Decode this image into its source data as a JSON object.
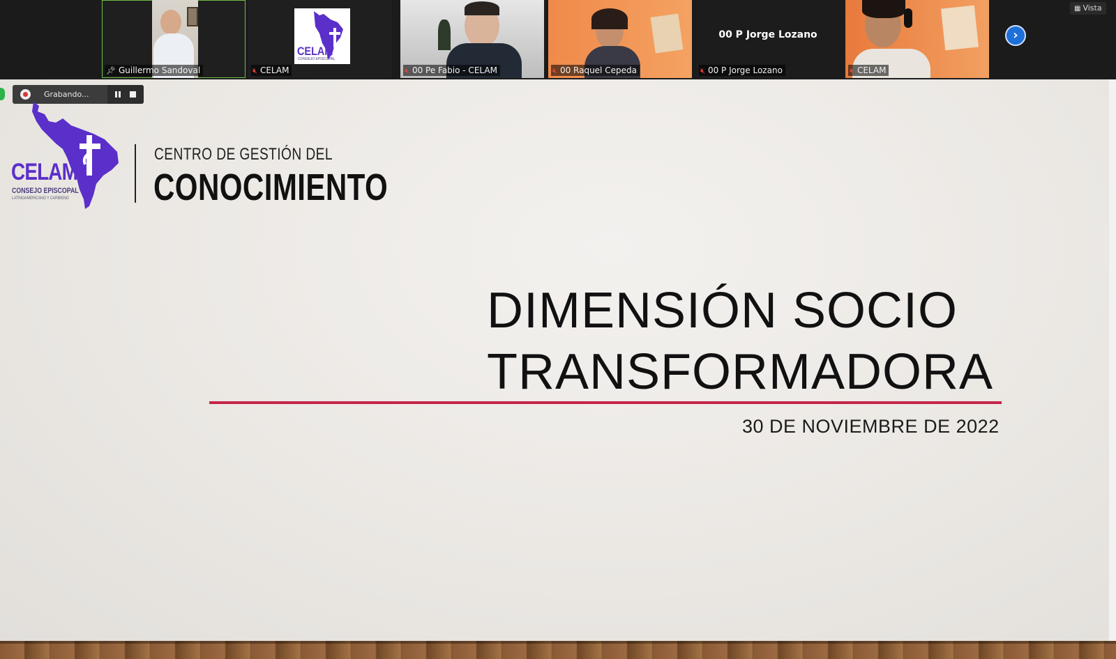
{
  "participants": [
    {
      "display_name": "Guillermo Sandoval",
      "mic": "pinned",
      "active": true
    },
    {
      "display_name": "CELAM",
      "mic": "muted",
      "active": false
    },
    {
      "display_name": "00 Pe Fabio - CELAM",
      "mic": "muted",
      "active": false
    },
    {
      "display_name": "00 Raquel Cepeda",
      "mic": "muted",
      "active": false
    },
    {
      "display_name": "00 P Jorge Lozano",
      "mic": "muted",
      "active": false,
      "video_off_label": "00 P Jorge Lozano"
    },
    {
      "display_name": "CELAM",
      "mic": "muted",
      "active": false
    }
  ],
  "view_button_label": "Vista",
  "recording": {
    "status_label": "Grabando..."
  },
  "slide": {
    "logo": {
      "brand": "CELAM",
      "brand_sub": "CONSEJO EPISCOPAL",
      "brand_sub2": "LATINOAMERICANO Y CARIBEÑO",
      "tile_logo_sub": "CONSEJO EPISCOPAL",
      "line1": "CENTRO DE GESTIÓN DEL",
      "line2": "CONOCIMIENTO"
    },
    "title_line1": "DIMENSIÓN SOCIO",
    "title_line2": "TRANSFORMADORA",
    "date": "30 DE NOVIEMBRE DE 2022"
  },
  "colors": {
    "brand_purple": "#5b2fc9",
    "accent_rule": "#c4264b",
    "active_speaker": "#6fbf4a",
    "muted_icon": "#e2453c",
    "next_button": "#1e6fd9"
  }
}
